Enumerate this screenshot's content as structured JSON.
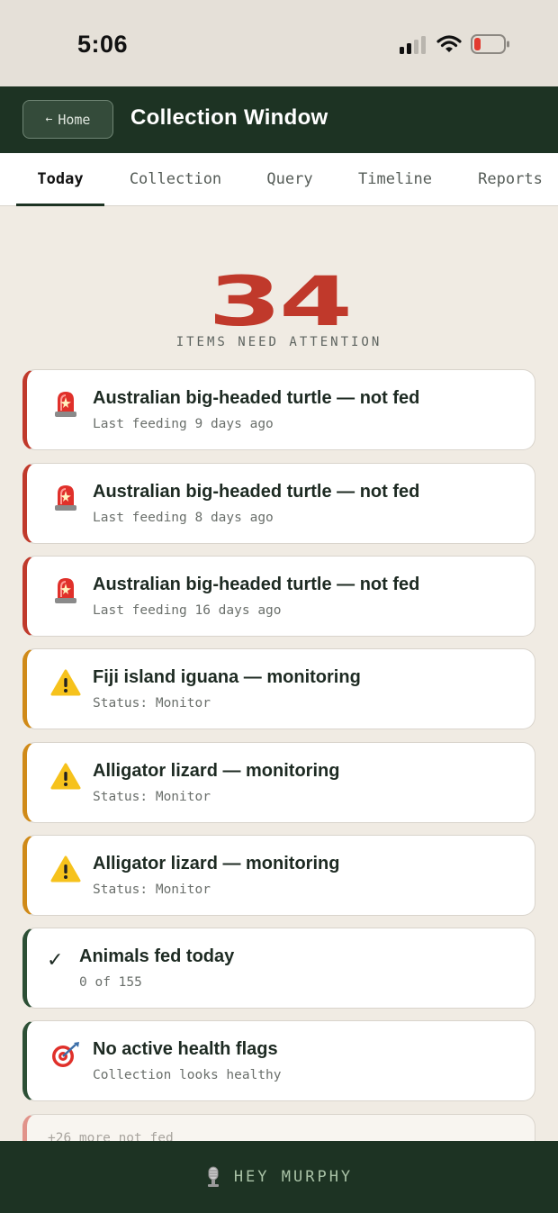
{
  "status_bar": {
    "time": "5:06"
  },
  "header": {
    "home_label": "Home",
    "title": "Collection Window"
  },
  "tabs": [
    {
      "label": "Today",
      "active": true
    },
    {
      "label": "Collection",
      "active": false
    },
    {
      "label": "Query",
      "active": false
    },
    {
      "label": "Timeline",
      "active": false
    },
    {
      "label": "Reports",
      "active": false
    }
  ],
  "summary": {
    "count": "34",
    "label": "ITEMS NEED ATTENTION"
  },
  "cards": [
    {
      "icon": "siren-icon",
      "severity": "alert",
      "title": "Australian big-headed turtle — not fed",
      "subtitle": "Last feeding 9 days ago"
    },
    {
      "icon": "siren-icon",
      "severity": "alert",
      "title": "Australian big-headed turtle — not fed",
      "subtitle": "Last feeding 8 days ago"
    },
    {
      "icon": "siren-icon",
      "severity": "alert",
      "title": "Australian big-headed turtle — not fed",
      "subtitle": "Last feeding 16 days ago"
    },
    {
      "icon": "warning-icon",
      "severity": "warn",
      "title": "Fiji island iguana — monitoring",
      "subtitle": "Status: Monitor"
    },
    {
      "icon": "warning-icon",
      "severity": "warn",
      "title": "Alligator lizard — monitoring",
      "subtitle": "Status: Monitor"
    },
    {
      "icon": "warning-icon",
      "severity": "warn",
      "title": "Alligator lizard — monitoring",
      "subtitle": "Status: Monitor"
    },
    {
      "icon": "check-icon",
      "severity": "ok",
      "title": "Animals fed today",
      "subtitle": "0 of 155"
    },
    {
      "icon": "target-icon",
      "severity": "ok",
      "title": "No active health flags",
      "subtitle": "Collection looks healthy"
    }
  ],
  "more_card": {
    "subtitle": "+26 more not fed"
  },
  "bottom_bar": {
    "label": "HEY MURPHY",
    "icon": "microphone-icon"
  },
  "colors": {
    "header_bg": "#1d3323",
    "alert": "#c0392b",
    "warn": "#d08a18",
    "ok": "#2c4f35",
    "background": "#f0ebe3"
  }
}
